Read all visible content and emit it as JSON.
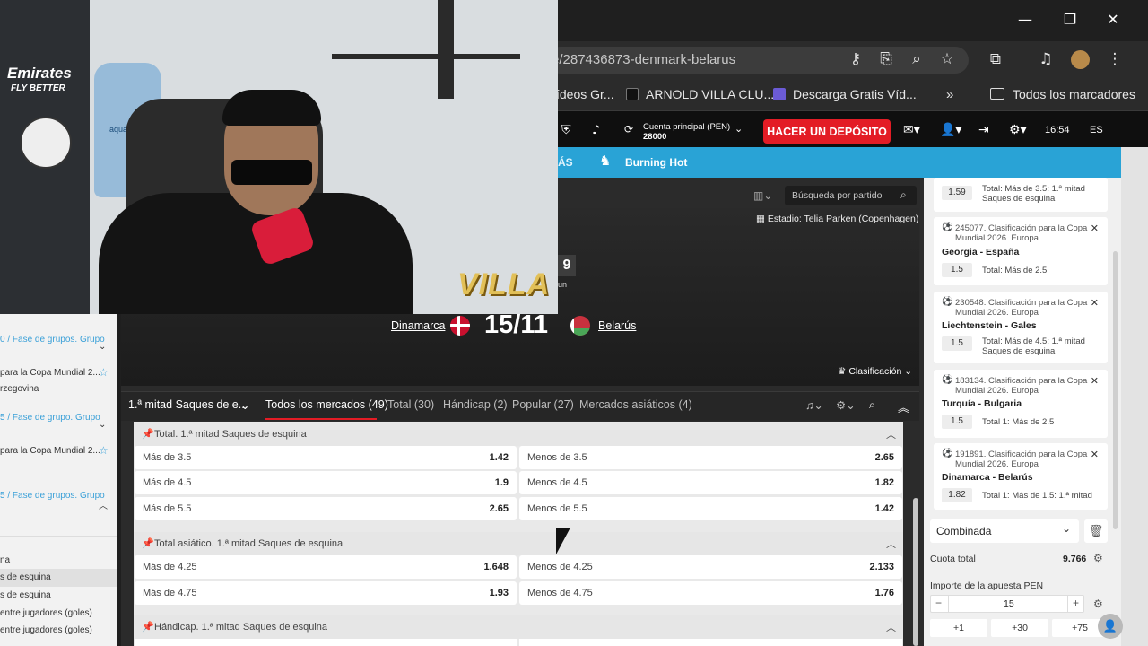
{
  "browser": {
    "url": "e/287436873-denmark-belarus",
    "bookmarks": [
      "ídeos Gr...",
      "ARNOLD VILLA CLU...",
      "Descarga Gratis Víd...",
      "Todos los marcadores"
    ],
    "window_controls": {
      "minimize": "—",
      "restore": "❐",
      "close": "✕"
    }
  },
  "header": {
    "account_label": "Cuenta principal  (PEN)",
    "account_balance": "28000",
    "deposit_label": "HACER UN DEPÓSITO",
    "time": "16:54",
    "lang": "ES"
  },
  "nav": {
    "more_label": "ÁS",
    "burning_label": "Burning Hot"
  },
  "search": {
    "placeholder": "Búsqueda por partido"
  },
  "match": {
    "stadium": "Estadio: Telia Parken (Copenhagen)",
    "home": "Dinamarca",
    "away": "Belarús",
    "date": "15/11",
    "badge_num": "9",
    "badge_sub": "un",
    "classification": "Clasificación"
  },
  "tabs": {
    "selector": "1.ª mitad Saques de e...",
    "items": [
      "Todos los mercados (49)",
      "Total (30)",
      "Hándicap (2)",
      "Popular (27)",
      "Mercados asiáticos (4)"
    ]
  },
  "markets": [
    {
      "title": "Total. 1.ª mitad Saques de esquina",
      "rows": [
        {
          "l": "Más de 3.5",
          "lo": "1.42",
          "r": "Menos de 3.5",
          "ro": "2.65"
        },
        {
          "l": "Más de 4.5",
          "lo": "1.9",
          "r": "Menos de 4.5",
          "ro": "1.82"
        },
        {
          "l": "Más de 5.5",
          "lo": "2.65",
          "r": "Menos de 5.5",
          "ro": "1.42"
        }
      ]
    },
    {
      "title": "Total asiático. 1.ª mitad Saques de esquina",
      "rows": [
        {
          "l": "Más de 4.25",
          "lo": "1.648",
          "r": "Menos de 4.25",
          "ro": "2.133"
        },
        {
          "l": "Más de 4.75",
          "lo": "1.93",
          "r": "Menos de 4.75",
          "ro": "1.76"
        }
      ]
    },
    {
      "title": "Hándicap. 1.ª mitad Saques de esquina",
      "rows": []
    }
  ],
  "left_panel": {
    "items": [
      {
        "text": "0 / Fase de grupos. Grupo",
        "blue": true
      },
      {
        "text": "para la Copa Mundial 2...",
        "blue": false
      },
      {
        "text": "rzegovina",
        "blue": false
      },
      {
        "text": "5 / Fase de grupo. Grupo",
        "blue": true
      },
      {
        "text": "para la Copa Mundial 2...",
        "blue": false
      },
      {
        "text": "5 / Fase de grupos. Grupo",
        "blue": true
      },
      {
        "text": "na",
        "blue": false
      },
      {
        "text": "s de esquina",
        "blue": false
      },
      {
        "text": "s de esquina",
        "blue": false
      },
      {
        "text": "entre jugadores (goles)",
        "blue": false
      },
      {
        "text": "entre jugadores (goles)",
        "blue": false
      }
    ]
  },
  "betslip": {
    "top_odds": "1.59",
    "top_bet": "Total: Más de 3.5: 1.ª mitad Saques de esquina",
    "cards": [
      {
        "title": "245077. Clasificación para la Copa Mundial 2026. Europa",
        "match": "Georgia - España",
        "odds": "1.5",
        "bet": "Total: Más de 2.5"
      },
      {
        "title": "230548. Clasificación para la Copa Mundial 2026. Europa",
        "match": "Liechtenstein - Gales",
        "odds": "1.5",
        "bet": "Total: Más de 4.5: 1.ª mitad Saques de esquina"
      },
      {
        "title": "183134. Clasificación para la Copa Mundial 2026. Europa",
        "match": "Turquía - Bulgaria",
        "odds": "1.5",
        "bet": "Total 1: Más de 2.5"
      },
      {
        "title": "191891. Clasificación para la Copa Mundial 2026. Europa",
        "match": "Dinamarca - Belarús",
        "odds": "1.82",
        "bet": "Total 1: Más de 1.5: 1.ª mitad"
      }
    ],
    "type": "Combinada",
    "total_label": "Cuota total",
    "total_value": "9.766",
    "stake_label": "Importe de la apuesta PEN",
    "stake_value": "15",
    "quick": [
      "+1",
      "+30",
      "+75"
    ]
  },
  "webcam": {
    "overlay": "VILLA",
    "shirt_text": "Emirates",
    "shirt_sub": "FLY BETTER",
    "bottle": "aqua"
  }
}
